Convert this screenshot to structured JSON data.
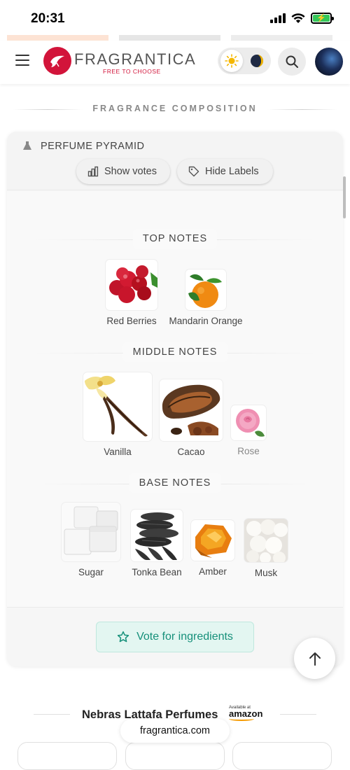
{
  "status_bar": {
    "time": "20:31"
  },
  "header": {
    "brand": "FRAGRANTICA",
    "tagline": "FREE TO CHOOSE"
  },
  "section": {
    "title": "FRAGRANCE COMPOSITION"
  },
  "pyramid": {
    "title": "PERFUME PYRAMID",
    "show_votes_label": "Show votes",
    "hide_labels_label": "Hide Labels",
    "top_label": "TOP NOTES",
    "top_notes": [
      "Red Berries",
      "Mandarin Orange"
    ],
    "middle_label": "MIDDLE NOTES",
    "middle_notes": [
      "Vanilla",
      "Cacao",
      "Rose"
    ],
    "base_label": "BASE NOTES",
    "base_notes": [
      "Sugar",
      "Tonka Bean",
      "Amber",
      "Musk"
    ],
    "vote_button_label": "Vote for ingredients"
  },
  "footer": {
    "brand_line": "Nebras Lattafa Perfumes",
    "amazon_available": "Available at",
    "amazon_word": "amazon",
    "url": "fragrantica.com"
  },
  "colors": {
    "brand_red": "#d2143a",
    "vote_green": "#16907a",
    "vote_bg": "#e3f6f1"
  },
  "icons": [
    "menu-icon",
    "fragrantica-logo-icon",
    "sun-icon",
    "moon-icon",
    "search-icon",
    "flask-icon",
    "bar-chart-icon",
    "tag-icon",
    "star-icon",
    "arrow-up-icon"
  ]
}
